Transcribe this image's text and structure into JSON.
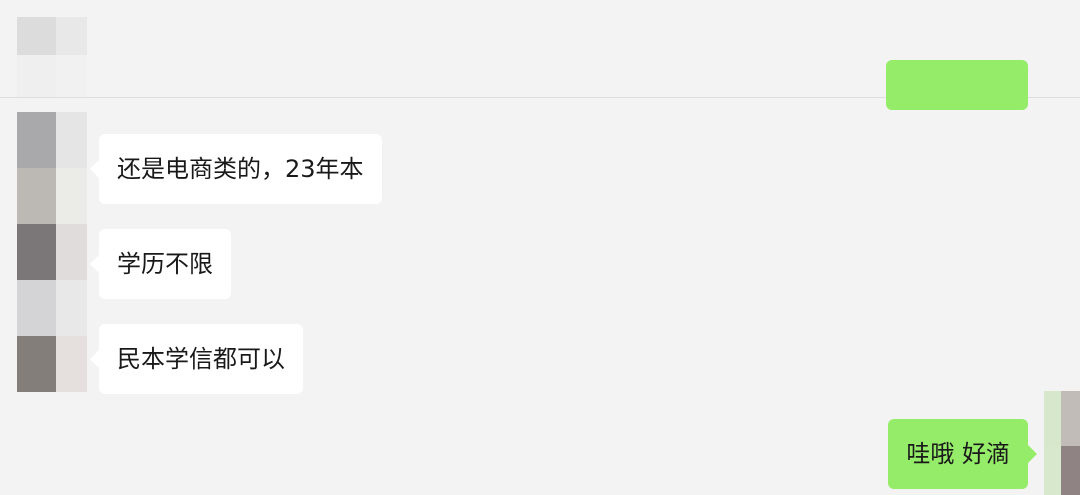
{
  "chat": {
    "messages": [
      {
        "sender": "contact",
        "text": "还是电商类的，23年本"
      },
      {
        "sender": "contact",
        "text": "学历不限"
      },
      {
        "sender": "contact",
        "text": "民本学信都可以"
      },
      {
        "sender": "self",
        "text": "哇哦 好滴"
      }
    ]
  },
  "colors": {
    "background": "#f3f3f3",
    "incoming_bubble": "#ffffff",
    "outgoing_bubble": "#95ec69",
    "text": "#191919"
  }
}
